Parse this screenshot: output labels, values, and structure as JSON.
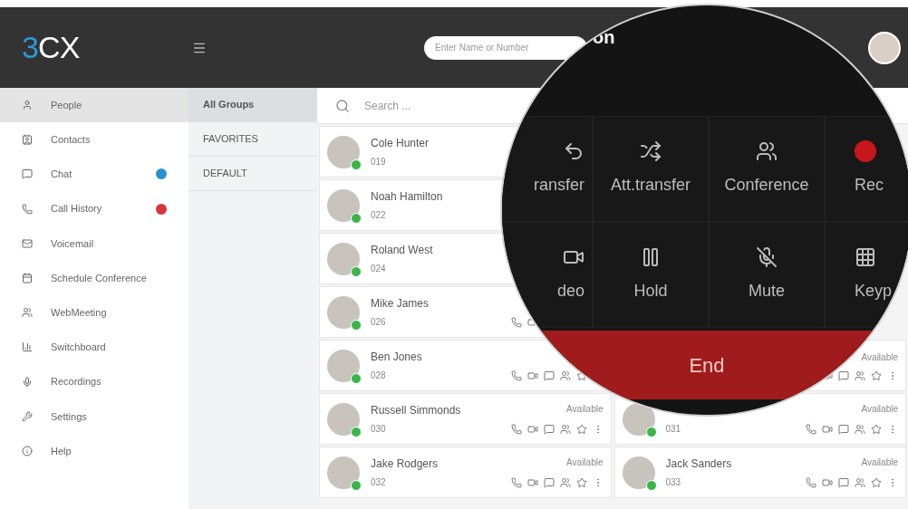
{
  "header": {
    "logo": {
      "digit": "3",
      "letters": "CX"
    },
    "search": {
      "placeholder": "Enter Name or Number"
    }
  },
  "sidebar": {
    "items": [
      {
        "label": "People",
        "selected": true
      },
      {
        "label": "Contacts",
        "selected": false
      },
      {
        "label": "Chat",
        "selected": false,
        "color": "#2a8fd0"
      },
      {
        "label": "Call History",
        "selected": false,
        "color": "#d8333f"
      },
      {
        "label": "Voicemail",
        "selected": false
      },
      {
        "label": "Schedule Conference",
        "selected": false
      },
      {
        "label": "WebMeeting",
        "selected": false
      },
      {
        "label": "Switchboard",
        "selected": false
      },
      {
        "label": "Recordings",
        "selected": false
      },
      {
        "label": "Settings",
        "selected": false
      },
      {
        "label": "Help",
        "selected": false
      }
    ]
  },
  "groups": [
    {
      "label": "All Groups",
      "selected": true
    },
    {
      "label": "FAVORITES",
      "selected": false
    },
    {
      "label": "DEFAULT",
      "selected": false
    }
  ],
  "contacts_search": {
    "placeholder": "Search ..."
  },
  "contacts_left": [
    {
      "name": "Cole Hunter",
      "ext": "019",
      "online": true
    },
    {
      "name": "Noah Hamilton",
      "ext": "022",
      "online": true
    },
    {
      "name": "Roland West",
      "ext": "024",
      "online": true
    },
    {
      "name": "Mike James",
      "ext": "026",
      "online": true
    },
    {
      "name": "Ben Jones",
      "ext": "028",
      "online": true
    },
    {
      "name": "Russell Simmonds",
      "ext": "030",
      "status": "Available",
      "online": true
    },
    {
      "name": "Jake Rodgers",
      "ext": "032",
      "status": "Available",
      "online": true
    }
  ],
  "contacts_right": [
    {
      "status": "Available"
    },
    {
      "ext": "031",
      "status": "Available",
      "online": true
    },
    {
      "name": "Jack Sanders",
      "ext": "033",
      "status": "Available",
      "online": true
    }
  ],
  "call_panel": {
    "title": "on",
    "buttons": [
      {
        "label": "ransfer"
      },
      {
        "label": "Att.transfer"
      },
      {
        "label": "Conference"
      },
      {
        "label": "Rec"
      },
      {
        "label": "deo"
      },
      {
        "label": "Hold"
      },
      {
        "label": "Mute"
      },
      {
        "label": "Keyp"
      }
    ],
    "end_button": "End"
  }
}
